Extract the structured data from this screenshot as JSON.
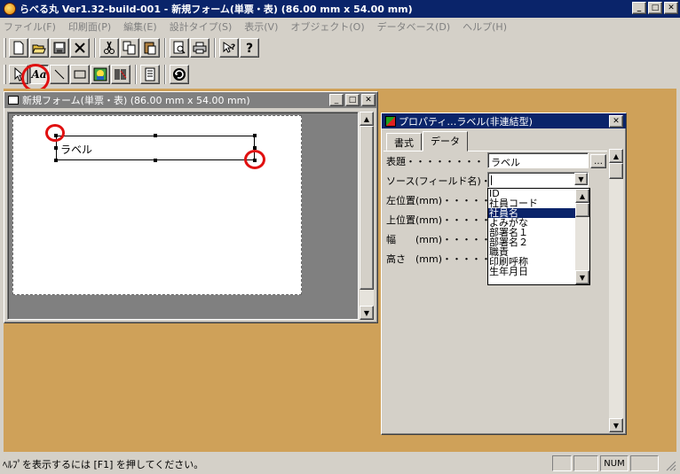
{
  "main_window": {
    "title": "らべる丸 Ver1.32-build-001 - 新規フォーム(単票・表) (86.00 mm x 54.00 mm)",
    "minimize": "_",
    "maximize": "□",
    "close": "✕"
  },
  "menu": [
    "ファイル(F)",
    "印刷面(P)",
    "編集(E)",
    "設計タイプ(S)",
    "表示(V)",
    "オブジェクト(O)",
    "データベース(D)",
    "ヘルプ(H)"
  ],
  "toolbar1": [
    "new-icon",
    "open-icon",
    "save-icon",
    "delete-icon",
    "cut-icon",
    "copy-icon",
    "paste-icon",
    "print-preview-icon",
    "print-icon",
    "pointer-help-icon",
    "help-icon"
  ],
  "toolbar2": [
    "select-icon",
    "text-label-icon",
    "line-icon",
    "rectangle-icon",
    "image-icon",
    "barcode-icon",
    "list-icon",
    "refresh-icon"
  ],
  "toolbar2_text_glyph": "Aa",
  "form_window": {
    "title": "新規フォーム(単票・表) (86.00 mm x 54.00 mm)",
    "label_text": "ラベル"
  },
  "property_window": {
    "title": "プロパティ…ラベル(非連結型)",
    "tabs": [
      "書式",
      "データ"
    ],
    "active_tab": "データ",
    "rows": [
      {
        "label": "表題・・・・・・・・・・",
        "value": "ラベル"
      },
      {
        "label": "ソース(フィールド名)・・・・",
        "value": ""
      },
      {
        "label": "左位置(mm)・・・・・・・",
        "value": ""
      },
      {
        "label": "上位置(mm)・・・・・・・",
        "value": ""
      },
      {
        "label": "幅　　(mm)・・・・・・・",
        "value": ""
      },
      {
        "label": "高さ　(mm)・・・・・・・",
        "value": ""
      }
    ],
    "ellipsis": "…",
    "dropdown_options": [
      "ID",
      "社員コード",
      "社員名",
      "よみがな",
      "部署名１",
      "部署名２",
      "職責",
      "印刷呼称",
      "生年月日"
    ],
    "dropdown_selected": "社員名"
  },
  "status_bar": {
    "text": "ﾍﾙﾌﾟを表示するには [F1] を押してください。",
    "num_indicator": "NUM"
  },
  "colors": {
    "title_active": "#0a246a",
    "workspace": "#cfa159",
    "highlight_circle": "#e01010"
  }
}
